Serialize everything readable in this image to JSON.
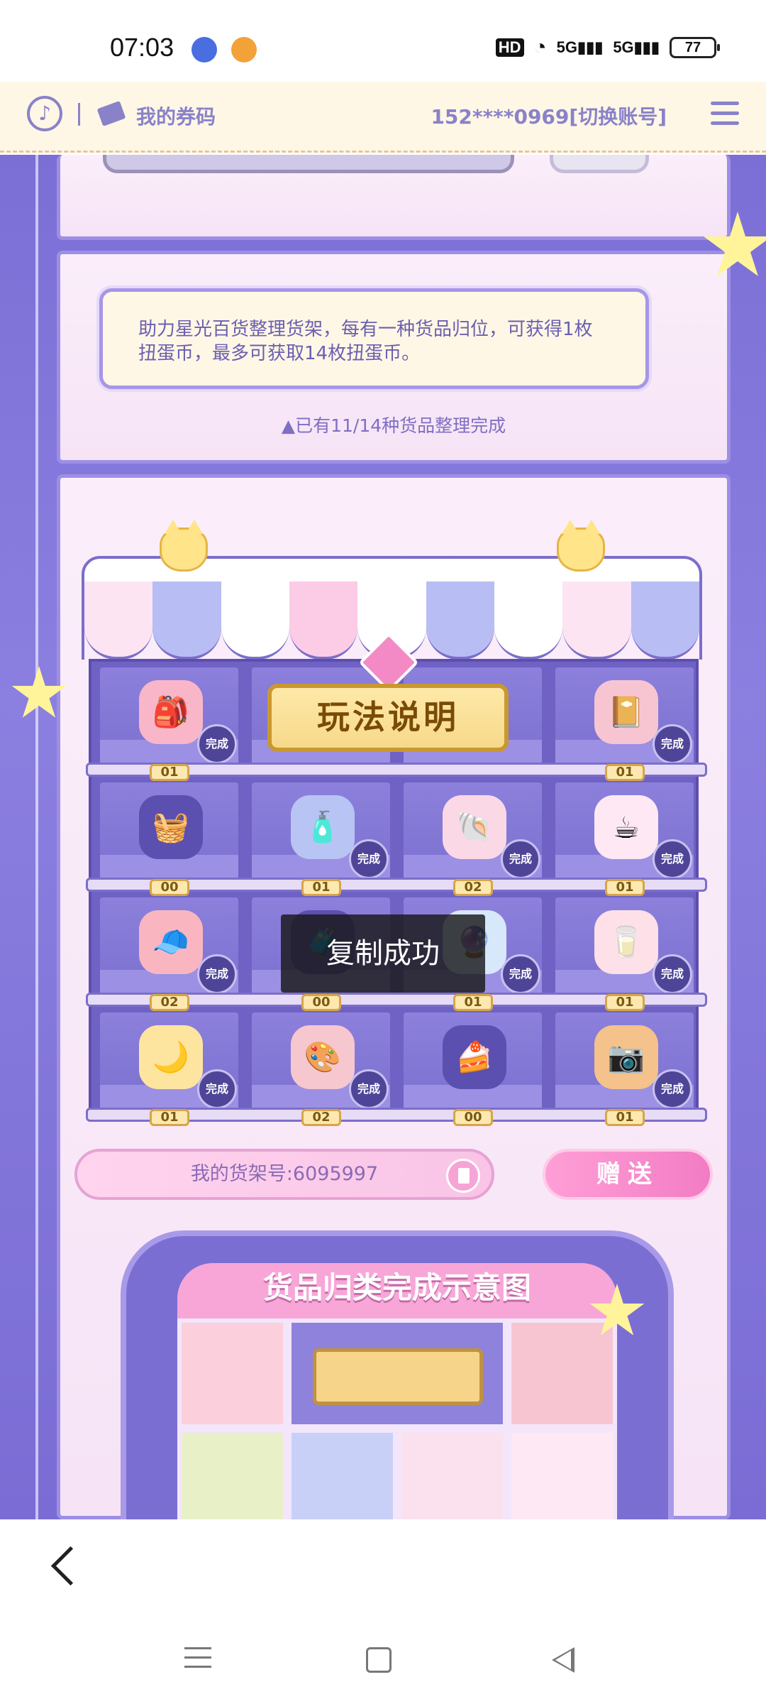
{
  "status_bar": {
    "time": "07:03",
    "network": "5G",
    "network2": "5G",
    "hd": "HD",
    "battery": "77",
    "icons": [
      "baidu-icon",
      "weibo-icon",
      "wifi-icon",
      "signal-icon"
    ]
  },
  "header": {
    "my_code": "我的券码",
    "account": "152****0969[切换账号]"
  },
  "notice": {
    "text": "助力星光百货整理货架，每有一种货品归位，可获得1枚扭蛋币，最多可获取14枚扭蛋币。",
    "progress": "▲已有11/14种货品整理完成"
  },
  "shop": {
    "howto": "玩法说明",
    "done_label": "完成",
    "rows": [
      {
        "counts": [
          "01",
          "",
          "",
          "01"
        ]
      },
      {
        "counts": [
          "00",
          "01",
          "02",
          "01"
        ]
      },
      {
        "counts": [
          "02",
          "00",
          "01",
          "01"
        ]
      },
      {
        "counts": [
          "01",
          "02",
          "00",
          "01"
        ]
      }
    ]
  },
  "shelf_id": "我的货架号:6095997",
  "gift": "赠送",
  "diagram_title": "货品归类完成示意图",
  "toast": "复制成功",
  "colors": {
    "accent": "#7b6fd6",
    "pink": "#f27cc4",
    "gold": "#f6d98a"
  }
}
